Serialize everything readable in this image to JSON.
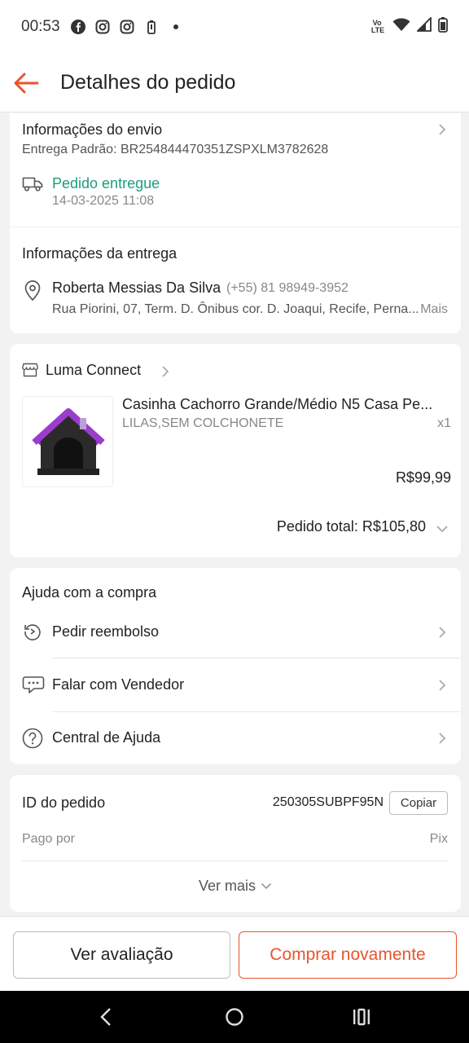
{
  "status_bar": {
    "time": "00:53",
    "lte": "Vo LTE"
  },
  "header": {
    "title": "Detalhes do pedido"
  },
  "shipping": {
    "title": "Informações do envio",
    "carrier": "Entrega Padrão: BR254844470351ZSPXLM3782628",
    "status": "Pedido entregue",
    "date": "14-03-2025 11:08",
    "status_color": "#1a9e7a"
  },
  "delivery": {
    "title": "Informações da entrega",
    "name": "Roberta Messias Da Silva",
    "phone": "(+55) 81 98949-3952",
    "address": "Rua Piorini, 07, Term. D. Ônibus cor. D. Joaqui, Recife, Perna...",
    "more": "Mais"
  },
  "shop": {
    "name": "Luma Connect",
    "product": {
      "title": "Casinha Cachorro Grande/Médio N5 Casa  Pe...",
      "variant": "LILAS,SEM COLCHONETE",
      "qty": "x1",
      "price": "R$99,99"
    },
    "total": "Pedido total: R$105,80"
  },
  "help": {
    "title": "Ajuda com a compra",
    "items": [
      {
        "label": "Pedir reembolso",
        "icon": "refund-icon"
      },
      {
        "label": "Falar com Vendedor",
        "icon": "chat-icon"
      },
      {
        "label": "Central de Ajuda",
        "icon": "help-icon"
      }
    ]
  },
  "order": {
    "id_label": "ID do pedido",
    "id_value": "250305SUBPF95N",
    "copy_label": "Copiar",
    "paid_label": "Pago por",
    "paid_value": "Pix",
    "see_more": "Ver mais"
  },
  "actions": {
    "review_label": "Ver avaliação",
    "rebuy_label": "Comprar novamente",
    "accent": "#e8542f"
  }
}
